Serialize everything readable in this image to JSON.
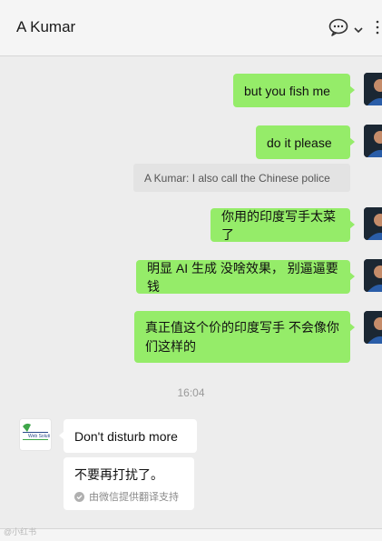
{
  "header": {
    "title": "A Kumar"
  },
  "messages_out": [
    {
      "text": "but  you fish me"
    },
    {
      "text": "do  it please"
    },
    {
      "text": "你用的印度写手太菜了"
    },
    {
      "text": "明显 AI 生成 没啥效果， 别逼逼要钱"
    },
    {
      "text": "真正值这个价的印度写手 不会像你们这样的"
    }
  ],
  "quote": {
    "text": "A Kumar: I also call the Chinese police"
  },
  "timestamp": "16:04",
  "messages_in": [
    {
      "text": "Don't disturb more"
    }
  ],
  "translation": {
    "text": "不要再打扰了。",
    "credit": "由微信提供翻译支持"
  },
  "avatar_them": {
    "logo_text": "Web Soluti"
  },
  "watermark": "@小红书",
  "colors": {
    "bubble_out": "#95ec69",
    "bubble_in": "#ffffff",
    "background": "#ededed"
  }
}
